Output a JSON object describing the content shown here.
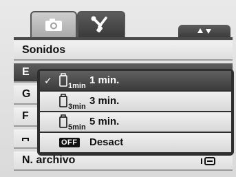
{
  "tabs": [
    {
      "icon": "camera-icon",
      "active": false
    },
    {
      "icon": "wrench-screwdriver-icon",
      "active": true
    }
  ],
  "nav_hint_icon": "up-down-arrows-icon",
  "menu": {
    "items": [
      {
        "label": "Sonidos"
      },
      {
        "label": "E",
        "selected": true
      },
      {
        "label": "G"
      },
      {
        "label": "F"
      },
      {
        "label": ""
      },
      {
        "label": "N. archivo",
        "icon": "file-number-icon"
      }
    ]
  },
  "submenu": {
    "options": [
      {
        "label": "1 min.",
        "icon_sub": "1min",
        "selected": true
      },
      {
        "label": "3 min.",
        "icon_sub": "3min",
        "selected": false
      },
      {
        "label": "5 min.",
        "icon_sub": "5min",
        "selected": false
      },
      {
        "label": "Desact",
        "badge": "OFF",
        "selected": false
      }
    ],
    "check_glyph": "✓"
  },
  "colors": {
    "selected_bg": "#4a4a4a",
    "row_bg": "#e6e6e6",
    "popup_frame": "#2e2e2e"
  }
}
